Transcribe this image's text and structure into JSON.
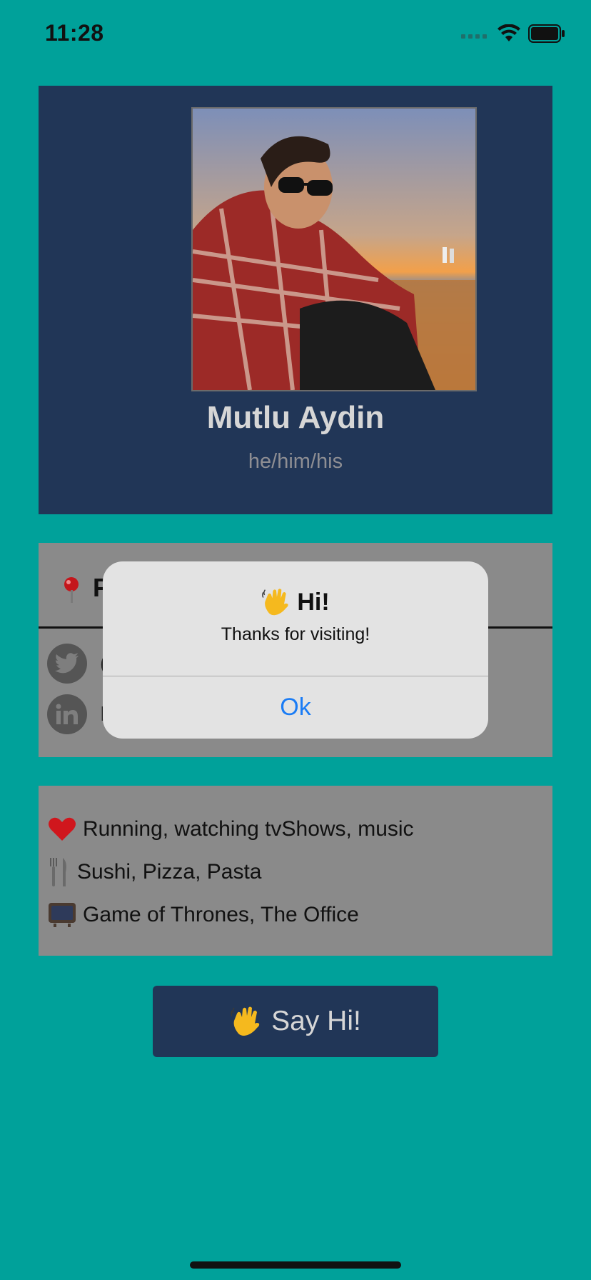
{
  "status_bar": {
    "time": "11:28"
  },
  "profile": {
    "name": "Mutlu Aydin",
    "pronouns": "he/him/his"
  },
  "info": {
    "header_visible_text": "P",
    "social": [
      {
        "icon": "twitter-icon",
        "visible_text": "("
      },
      {
        "icon": "linkedin-icon",
        "visible_text": "I"
      }
    ]
  },
  "interests": [
    {
      "icon": "heart-icon",
      "text": "Running, watching tvShows, music"
    },
    {
      "icon": "fork-knife-icon",
      "text": "Sushi, Pizza, Pasta"
    },
    {
      "icon": "tv-icon",
      "text": "Game of Thrones, The Office"
    }
  ],
  "say_hi_button": {
    "label": "Say Hi!",
    "icon": "waving-hand-icon"
  },
  "alert": {
    "title": "Hi!",
    "title_icon": "waving-hand-icon",
    "message": "Thanks for visiting!",
    "ok_label": "Ok"
  },
  "colors": {
    "background": "#00A19A",
    "card_dark": "#213657",
    "card_gray": "#8a8a8a",
    "alert_bg": "#e3e3e3",
    "alert_link": "#1a7cf5"
  }
}
